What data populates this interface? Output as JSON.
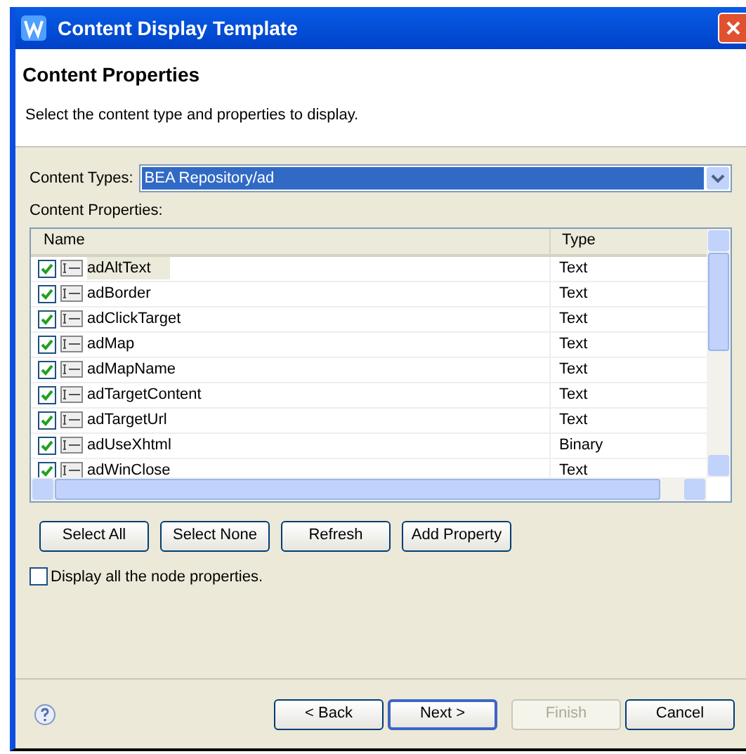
{
  "window": {
    "title": "Content Display Template"
  },
  "header": {
    "title": "Content Properties",
    "description": "Select the content type and properties to display."
  },
  "content_types": {
    "label": "Content Types:",
    "value": "BEA Repository/ad"
  },
  "properties_label": "Content Properties:",
  "table": {
    "columns": [
      "Name",
      "Type"
    ],
    "rows": [
      {
        "name": "adAltText",
        "type": "Text",
        "checked": true,
        "selected": true
      },
      {
        "name": "adBorder",
        "type": "Text",
        "checked": true,
        "selected": false
      },
      {
        "name": "adClickTarget",
        "type": "Text",
        "checked": true,
        "selected": false
      },
      {
        "name": "adMap",
        "type": "Text",
        "checked": true,
        "selected": false
      },
      {
        "name": "adMapName",
        "type": "Text",
        "checked": true,
        "selected": false
      },
      {
        "name": "adTargetContent",
        "type": "Text",
        "checked": true,
        "selected": false
      },
      {
        "name": "adTargetUrl",
        "type": "Text",
        "checked": true,
        "selected": false
      },
      {
        "name": "adUseXhtml",
        "type": "Binary",
        "checked": true,
        "selected": false
      },
      {
        "name": "adWinClose",
        "type": "Text",
        "checked": true,
        "selected": false
      }
    ]
  },
  "actions": [
    "Select All",
    "Select None",
    "Refresh",
    "Add Property"
  ],
  "display_all": {
    "label": "Display all the node properties.",
    "checked": false
  },
  "footer_buttons": [
    {
      "label": "< Back",
      "disabled": false,
      "default": false
    },
    {
      "label": "Next >",
      "disabled": false,
      "default": true
    },
    {
      "label": "Finish",
      "disabled": true,
      "default": false
    },
    {
      "label": "Cancel",
      "disabled": false,
      "default": false
    }
  ]
}
